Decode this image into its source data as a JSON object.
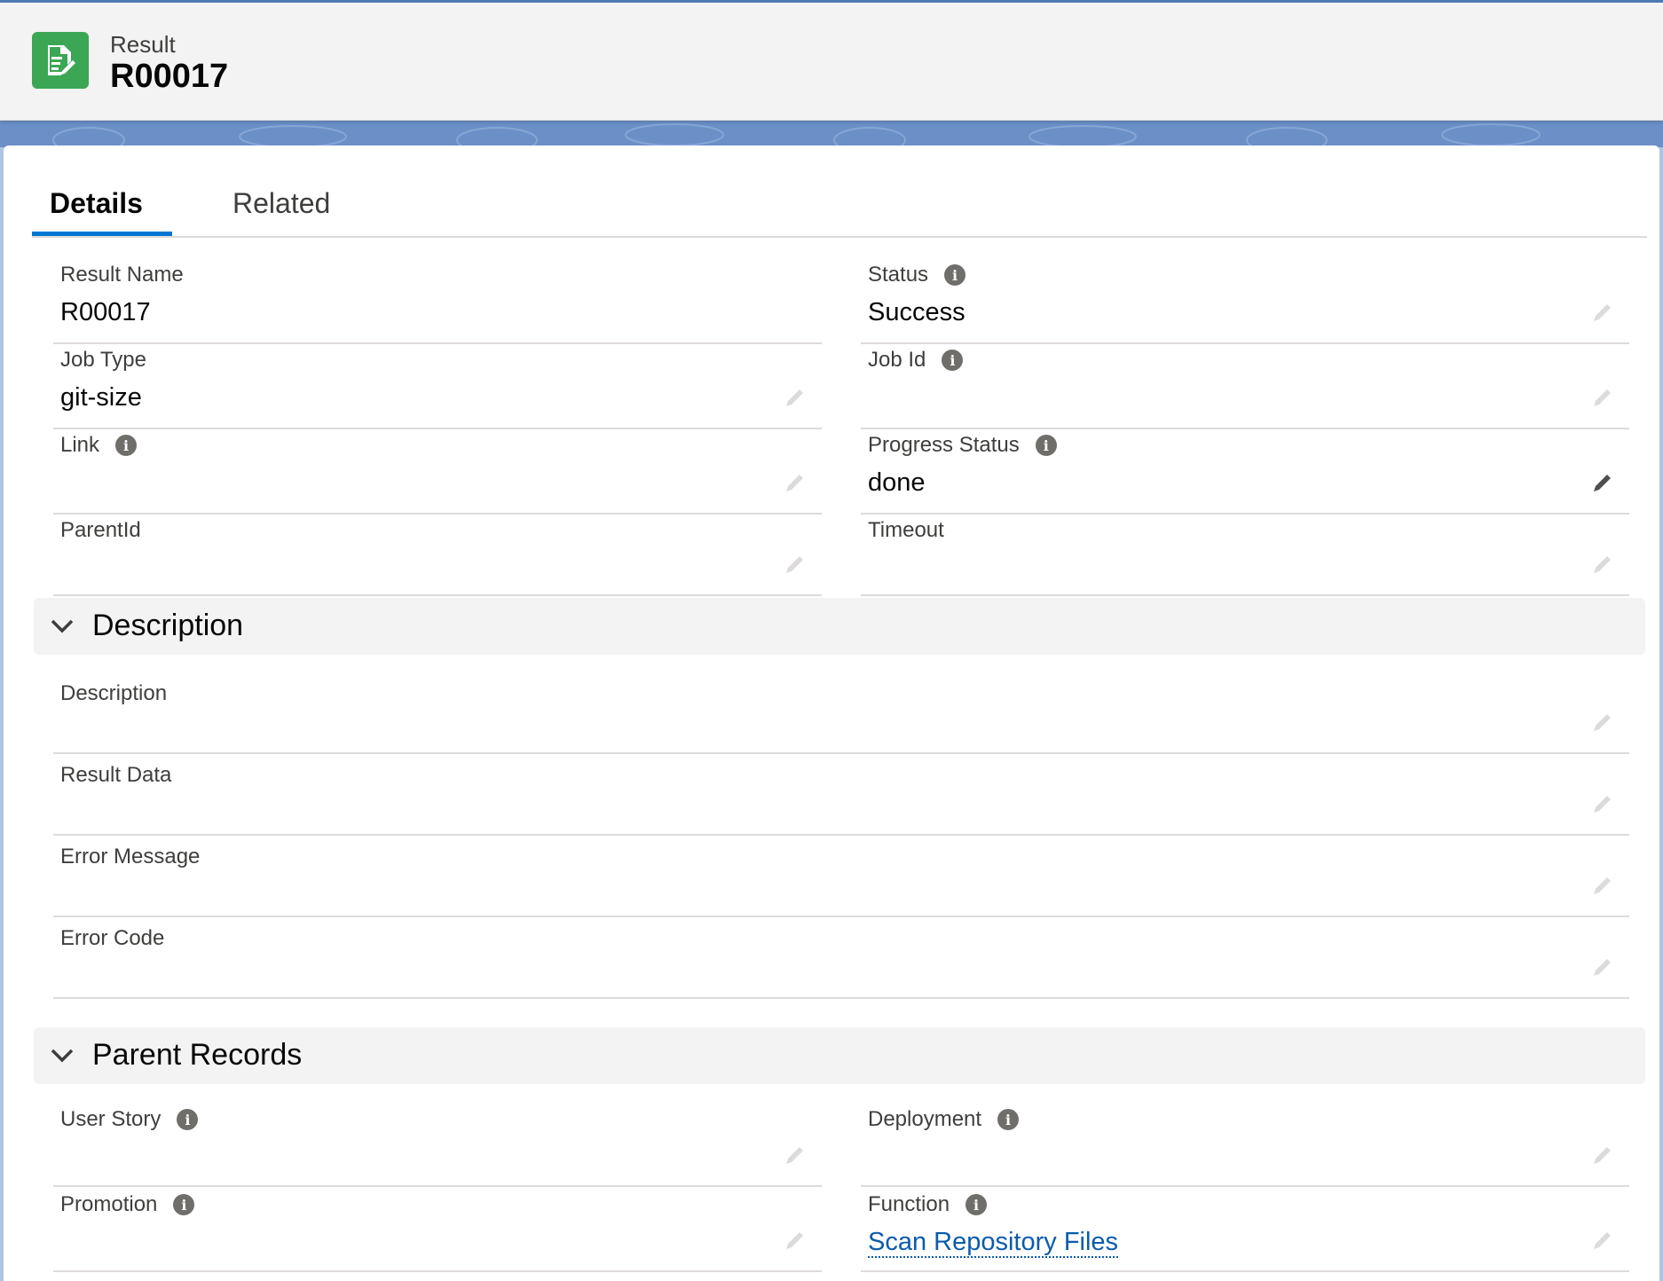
{
  "header": {
    "object_label": "Result",
    "record_title": "R00017",
    "icon": "record-edit-icon",
    "icon_color": "#3ba755"
  },
  "tabs": [
    {
      "label": "Details",
      "active": true
    },
    {
      "label": "Related",
      "active": false
    }
  ],
  "fields": {
    "result_name": {
      "label": "Result Name",
      "value": "R00017"
    },
    "status": {
      "label": "Status",
      "value": "Success"
    },
    "job_type": {
      "label": "Job Type",
      "value": "git-size"
    },
    "job_id": {
      "label": "Job Id",
      "value": ""
    },
    "link": {
      "label": "Link",
      "value": ""
    },
    "progress_status": {
      "label": "Progress Status",
      "value": "done"
    },
    "parent_id": {
      "label": "ParentId",
      "value": ""
    },
    "timeout": {
      "label": "Timeout",
      "value": ""
    },
    "description": {
      "label": "Description",
      "value": ""
    },
    "result_data": {
      "label": "Result Data",
      "value": ""
    },
    "error_message": {
      "label": "Error Message",
      "value": ""
    },
    "error_code": {
      "label": "Error Code",
      "value": ""
    },
    "user_story": {
      "label": "User Story",
      "value": ""
    },
    "deployment": {
      "label": "Deployment",
      "value": ""
    },
    "promotion": {
      "label": "Promotion",
      "value": ""
    },
    "function": {
      "label": "Function",
      "value": "Scan Repository Files"
    }
  },
  "sections": {
    "description": {
      "title": "Description"
    },
    "parent_records": {
      "title": "Parent Records"
    }
  },
  "colors": {
    "accent": "#0176d3",
    "link": "#0b5cab",
    "section_bg": "#f3f3f3",
    "banner": "#6b8fc7"
  },
  "icons": {
    "info": "info-icon",
    "edit": "pencil-icon",
    "collapse": "chevron-down-icon"
  }
}
